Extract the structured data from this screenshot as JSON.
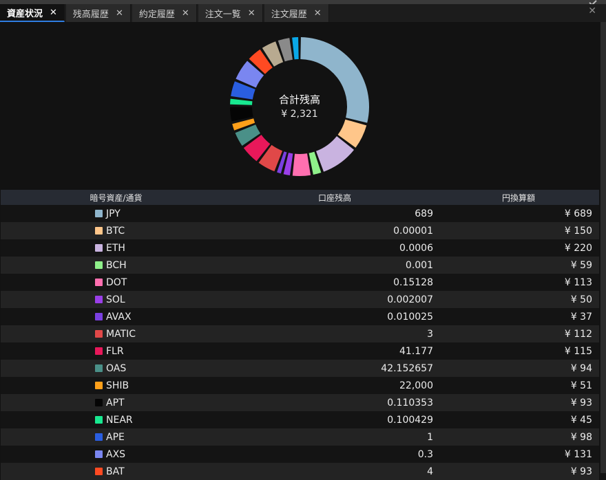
{
  "tabs": [
    {
      "label": "資産状況",
      "active": true
    },
    {
      "label": "残高履歴",
      "active": false
    },
    {
      "label": "約定履歴",
      "active": false
    },
    {
      "label": "注文一覧",
      "active": false
    },
    {
      "label": "注文履歴",
      "active": false
    }
  ],
  "tab_close_glyph": "✕",
  "panel_close_glyph": "✕",
  "donut": {
    "center_title": "合計残高",
    "center_value": "¥ 2,321"
  },
  "table": {
    "headers": [
      "暗号資産/通貨",
      "口座残高",
      "円換算額"
    ],
    "rows": [
      {
        "symbol": "JPY",
        "balance": "689",
        "jpy": "¥ 689",
        "jpy_value": 689,
        "color": "#8fb5cc"
      },
      {
        "symbol": "BTC",
        "balance": "0.00001",
        "jpy": "¥ 150",
        "jpy_value": 150,
        "color": "#ffc68a"
      },
      {
        "symbol": "ETH",
        "balance": "0.0006",
        "jpy": "¥ 220",
        "jpy_value": 220,
        "color": "#c9b3e0"
      },
      {
        "symbol": "BCH",
        "balance": "0.001",
        "jpy": "¥ 59",
        "jpy_value": 59,
        "color": "#8ff08a"
      },
      {
        "symbol": "DOT",
        "balance": "0.15128",
        "jpy": "¥ 113",
        "jpy_value": 113,
        "color": "#ff6fb0"
      },
      {
        "symbol": "SOL",
        "balance": "0.002007",
        "jpy": "¥ 50",
        "jpy_value": 50,
        "color": "#9a3fe8"
      },
      {
        "symbol": "AVAX",
        "balance": "0.010025",
        "jpy": "¥ 37",
        "jpy_value": 37,
        "color": "#7a40e0"
      },
      {
        "symbol": "MATIC",
        "balance": "3",
        "jpy": "¥ 112",
        "jpy_value": 112,
        "color": "#e04848"
      },
      {
        "symbol": "FLR",
        "balance": "41.177",
        "jpy": "¥ 115",
        "jpy_value": 115,
        "color": "#e8185a"
      },
      {
        "symbol": "OAS",
        "balance": "42.152657",
        "jpy": "¥ 94",
        "jpy_value": 94,
        "color": "#4a9088"
      },
      {
        "symbol": "SHIB",
        "balance": "22,000",
        "jpy": "¥ 51",
        "jpy_value": 51,
        "color": "#ffa01a"
      },
      {
        "symbol": "APT",
        "balance": "0.110353",
        "jpy": "¥ 93",
        "jpy_value": 93,
        "color": "#050505"
      },
      {
        "symbol": "NEAR",
        "balance": "0.100429",
        "jpy": "¥ 45",
        "jpy_value": 45,
        "color": "#18e890"
      },
      {
        "symbol": "APE",
        "balance": "1",
        "jpy": "¥ 98",
        "jpy_value": 98,
        "color": "#2a5ee0"
      },
      {
        "symbol": "AXS",
        "balance": "0.3",
        "jpy": "¥ 131",
        "jpy_value": 131,
        "color": "#7a86f0"
      },
      {
        "symbol": "BAT",
        "balance": "4",
        "jpy": "¥ 93",
        "jpy_value": 93,
        "color": "#ff4a22"
      }
    ]
  },
  "donut_extra_segments": [
    {
      "value": 95,
      "color": "#b8aa90"
    },
    {
      "value": 78,
      "color": "#8a8a8a"
    },
    {
      "value": 48,
      "color": "#0aa8e8"
    }
  ]
}
